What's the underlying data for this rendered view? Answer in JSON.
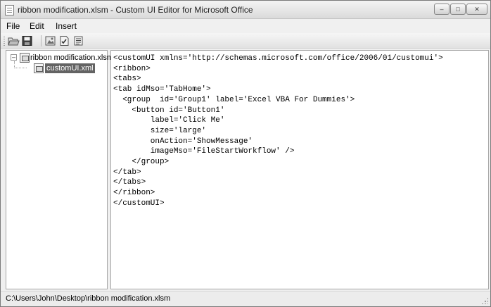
{
  "window": {
    "title": "ribbon modification.xlsm - Custom UI Editor for Microsoft Office",
    "controls": {
      "minimize": "–",
      "maximize": "□",
      "close": "✕"
    }
  },
  "menu": {
    "items": [
      "File",
      "Edit",
      "Insert"
    ]
  },
  "toolbar": {
    "buttons": [
      "open-icon",
      "save-icon",
      "insert-icons-icon",
      "validate-icon",
      "generate-callbacks-icon"
    ]
  },
  "tree": {
    "root": {
      "label": "ribbon modification.xlsm",
      "expander": "–"
    },
    "child": {
      "label": "customUI.xml"
    }
  },
  "editor": {
    "lines": [
      "<customUI xmlns='http://schemas.microsoft.com/office/2006/01/customui'>",
      "<ribbon>",
      "<tabs>",
      "<tab idMso='TabHome'>",
      "  <group  id='Group1' label='Excel VBA For Dummies'>",
      "    <button id='Button1'",
      "        label='Click Me'",
      "        size='large'",
      "        onAction='ShowMessage'",
      "        imageMso='FileStartWorkflow' />",
      "    </group>",
      "</tab>",
      "</tabs>",
      "</ribbon>",
      "</customUI>"
    ]
  },
  "status": {
    "path": "C:\\Users\\John\\Desktop\\ribbon modification.xlsm"
  }
}
